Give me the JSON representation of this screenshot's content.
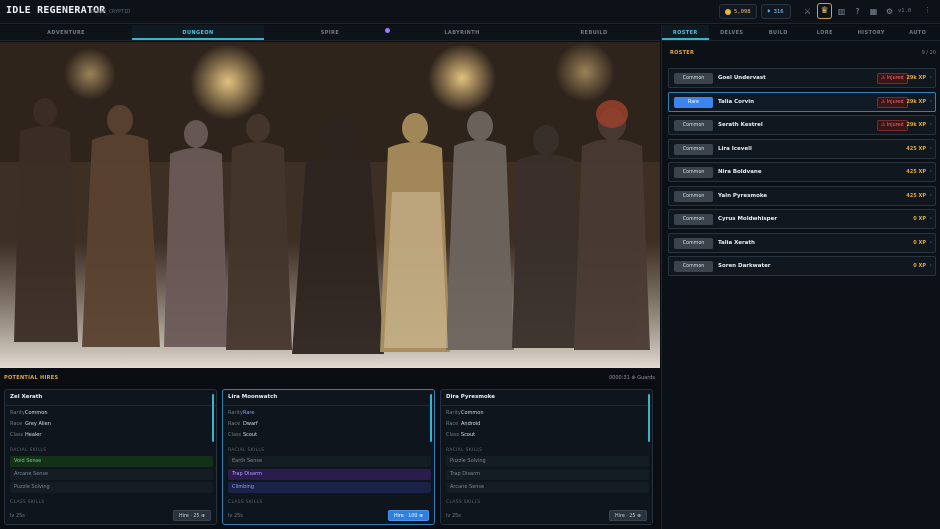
{
  "app": {
    "title": "IDLE REGENERATOR",
    "subtitle": "OCEAN_CRYPTID",
    "gold": "5,098",
    "gems": "316",
    "version": "v1.0",
    "icons": [
      "swords-icon",
      "trophy-icon",
      "chart-icon",
      "help-icon",
      "calendar-icon",
      "settings-icon",
      "more-icon"
    ]
  },
  "main_tabs": [
    {
      "label": "ADVENTURE",
      "active": false
    },
    {
      "label": "DUNGEON",
      "active": true
    },
    {
      "label": "SPIRE",
      "active": false
    },
    {
      "label": "LABYRINTH",
      "active": false
    },
    {
      "label": "REBUILD",
      "active": false
    }
  ],
  "hires": {
    "title": "POTENTIAL HIRES",
    "note": "0000:31 ⊕ Guards",
    "cards": [
      {
        "name": "Zel Xerath",
        "rarity": "Common",
        "race": "Grey Alien",
        "class": "Healer",
        "racial_label": "RACIAL SKILLS",
        "racial": [
          "Void Sense",
          "Arcane Sense",
          "Puzzle Solving"
        ],
        "class_label": "CLASS SKILLS",
        "level": "lv 25s",
        "hire": "Hire · 25 ⊕",
        "selected": false
      },
      {
        "name": "Lira Moonwatch",
        "rarity": "Rare",
        "race": "Dwarf",
        "class": "Scout",
        "racial_label": "RACIAL SKILLS",
        "racial": [
          "Earth Sense",
          "Trap Disarm",
          "Climbing"
        ],
        "class_label": "CLASS SKILLS",
        "level": "lv 25s",
        "hire": "Hire · 100 ⊕",
        "selected": true
      },
      {
        "name": "Dira Pyresmoke",
        "rarity": "Common",
        "race": "Android",
        "class": "Scout",
        "racial_label": "RACIAL SKILLS",
        "racial": [
          "Puzzle Solving",
          "Trap Disarm",
          "Arcane Sense"
        ],
        "class_label": "CLASS SKILLS",
        "level": "lv 25s",
        "hire": "Hire · 25 ⊕",
        "selected": false
      }
    ],
    "labels": {
      "rarity": "Rarity",
      "race": "Race",
      "class": "Class"
    }
  },
  "side_tabs": [
    {
      "label": "ROSTER",
      "active": true
    },
    {
      "label": "DELVES",
      "active": false
    },
    {
      "label": "BUILD",
      "active": false
    },
    {
      "label": "LORE",
      "active": false
    },
    {
      "label": "HISTORY",
      "active": false
    },
    {
      "label": "AUTO",
      "active": false
    }
  ],
  "roster": {
    "title": "ROSTER",
    "count": "9 / 20",
    "heroes": [
      {
        "rarity": "Common",
        "name": "Goel Undervast",
        "injured": "⚠ Injured",
        "xp": "29k XP"
      },
      {
        "rarity": "Rare",
        "name": "Talia Corvin",
        "injured": "⚠ Injured",
        "xp": "29k XP"
      },
      {
        "rarity": "Common",
        "name": "Serath Kestrel",
        "injured": "⚠ Injured",
        "xp": "29k XP"
      },
      {
        "rarity": "Common",
        "name": "Lira Icevell",
        "injured": "",
        "xp": "425 XP"
      },
      {
        "rarity": "Common",
        "name": "Nira Boldvane",
        "injured": "",
        "xp": "425 XP"
      },
      {
        "rarity": "Common",
        "name": "Yaln Pyresmoke",
        "injured": "",
        "xp": "425 XP"
      },
      {
        "rarity": "Common",
        "name": "Cyrus Moldwhisper",
        "injured": "",
        "xp": "0 XP"
      },
      {
        "rarity": "Common",
        "name": "Talia Xerath",
        "injured": "",
        "xp": "0 XP"
      },
      {
        "rarity": "Common",
        "name": "Soren Darkwater",
        "injured": "",
        "xp": "0 XP"
      }
    ]
  },
  "colors": {
    "accent": "#33b7cf",
    "gold": "#e4a93c",
    "rare": "#3c85f0",
    "injured": "#ff6c6c",
    "panel": "#0c1117"
  }
}
